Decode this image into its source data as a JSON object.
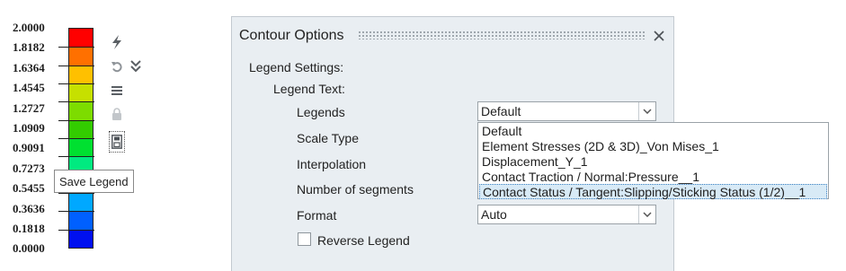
{
  "legend": {
    "values": [
      "2.0000",
      "1.8182",
      "1.6364",
      "1.4545",
      "1.2727",
      "1.0909",
      "0.9091",
      "0.7273",
      "0.5455",
      "0.3636",
      "0.1818",
      "0.0000"
    ],
    "colors": [
      "#ff0000",
      "#ff7000",
      "#ffc000",
      "#c6e000",
      "#7ddc00",
      "#33cc00",
      "#00e030",
      "#00ea80",
      "#00d8d8",
      "#00a8ff",
      "#0060ff",
      "#0010f0"
    ]
  },
  "toolbar": {
    "icons": [
      "lightning-icon",
      "undo-icon",
      "expand-chevron-icon",
      "list-icon",
      "lock-icon",
      "save-legend-icon"
    ],
    "tooltip": "Save Legend"
  },
  "dialog": {
    "title": "Contour Options",
    "legend_settings_label": "Legend Settings:",
    "legend_text_label": "Legend Text:",
    "fields": {
      "legends": "Legends",
      "scale_type": "Scale Type",
      "interpolation": "Interpolation",
      "number_of_segments": "Number of segments",
      "format": "Format"
    },
    "legends_value": "Default",
    "legends_options": [
      "Default",
      "Element Stresses (2D & 3D)_Von Mises_1",
      "Displacement_Y_1",
      "Contact Traction / Normal:Pressure__1",
      "Contact Status / Tangent:Slipping/Sticking Status (1/2)__1"
    ],
    "highlighted_option_index": 4,
    "format_value": "Auto",
    "reverse_legend_label": "Reverse Legend",
    "reverse_legend_checked": false
  }
}
